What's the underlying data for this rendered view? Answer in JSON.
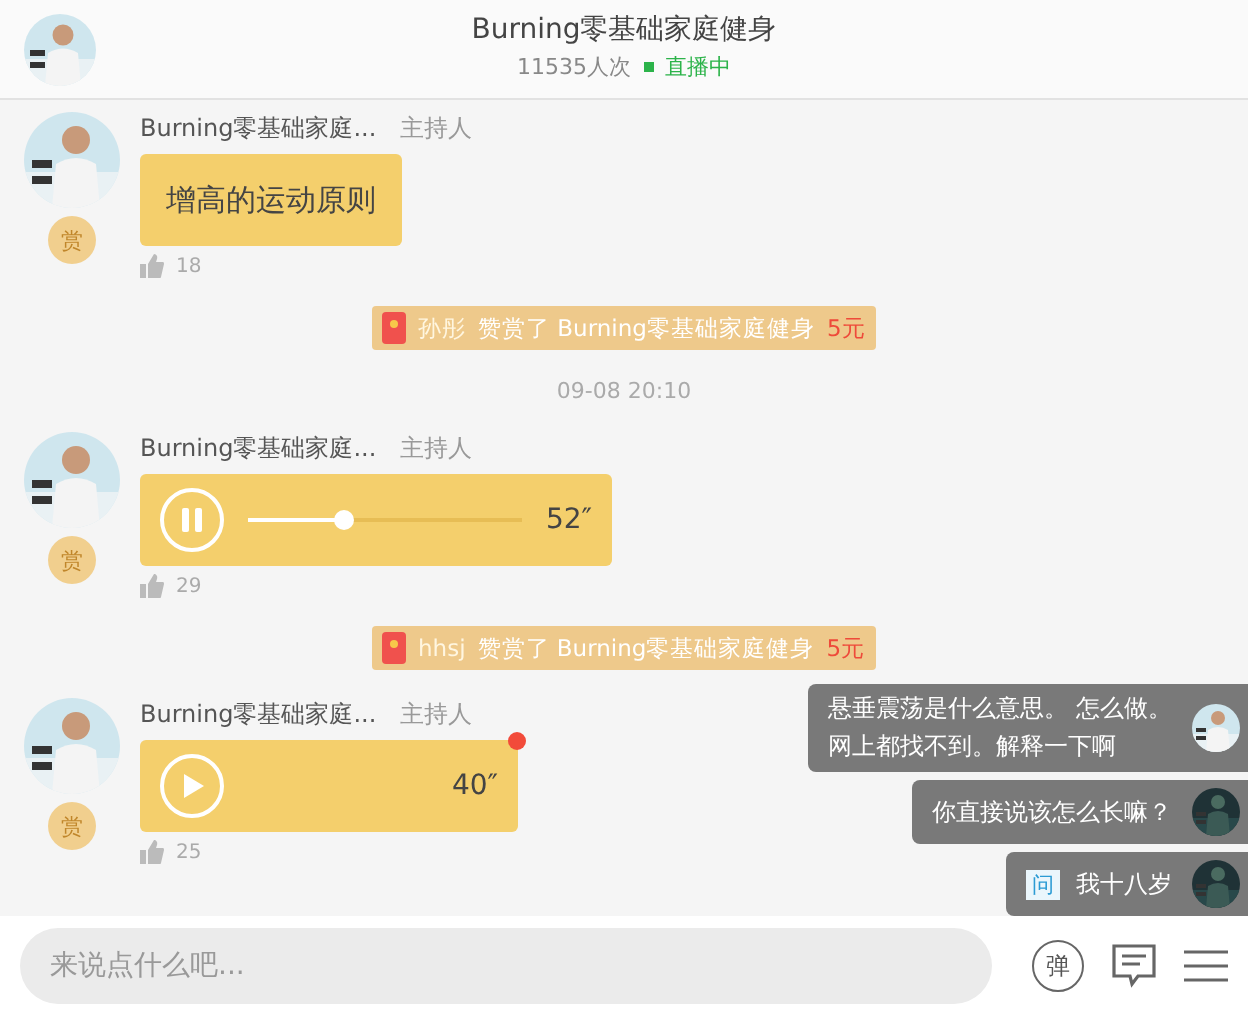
{
  "header": {
    "title": "Burning零基础家庭健身",
    "viewers": "11535人次",
    "status": "直播中",
    "live": true
  },
  "feed": [
    {
      "kind": "text",
      "sender": "Burning零基础家庭...",
      "role": "主持人",
      "reward": "赏",
      "text": "增高的运动原则",
      "likes": "18"
    },
    {
      "kind": "gift",
      "sender": "孙彤",
      "action": "赞赏了 Burning零基础家庭健身",
      "amount": "5元"
    },
    {
      "kind": "time",
      "text": "09-08 20:10"
    },
    {
      "kind": "voice",
      "sender": "Burning零基础家庭...",
      "role": "主持人",
      "reward": "赏",
      "playing": true,
      "level": 0.35,
      "duration": "52″",
      "unread": false,
      "likes": "29"
    },
    {
      "kind": "gift",
      "sender": "hhsj",
      "action": "赞赏了 Burning零基础家庭健身",
      "amount": "5元"
    },
    {
      "kind": "voice",
      "sender": "Burning零基础家庭...",
      "role": "主持人",
      "reward": "赏",
      "playing": false,
      "duration": "40″",
      "unread": true,
      "likes": "25"
    }
  ],
  "danmaku": [
    {
      "lines": [
        "悬垂震荡是什么意思。 怎么做。",
        "网上都找不到。解释一下啊"
      ],
      "question": false
    },
    {
      "lines": [
        "你直接说该怎么长嘛？"
      ],
      "question": false
    },
    {
      "lines": [
        "我十八岁"
      ],
      "question": true,
      "badge": "问"
    }
  ],
  "footer": {
    "placeholder": "来说点什么吧...",
    "danmaku_button": "弹"
  }
}
